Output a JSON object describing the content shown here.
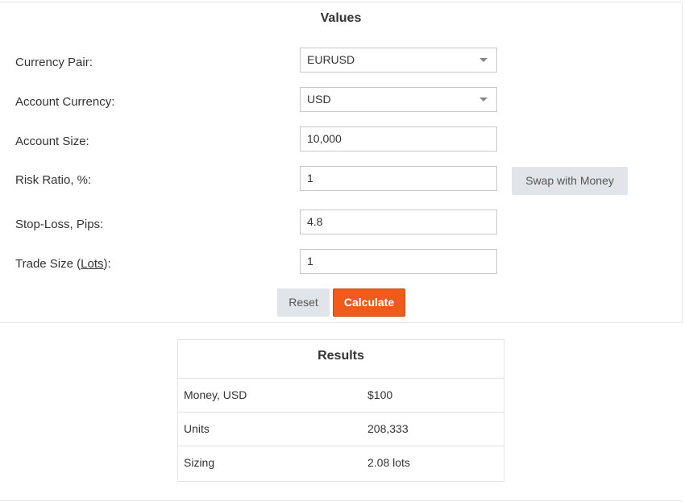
{
  "values": {
    "title": "Values",
    "currency_pair": {
      "label": "Currency Pair:",
      "value": "EURUSD"
    },
    "account_currency": {
      "label": "Account Currency:",
      "value": "USD"
    },
    "account_size": {
      "label": "Account Size:",
      "value": "10,000"
    },
    "risk_ratio": {
      "label": "Risk Ratio, %:",
      "value": "1"
    },
    "swap_button": "Swap with Money",
    "stop_loss": {
      "label": "Stop-Loss, Pips:",
      "value": "4.8"
    },
    "trade_size": {
      "label_prefix": "Trade Size (",
      "label_link": "Lots",
      "label_suffix": "):",
      "value": "1"
    },
    "reset_button": "Reset",
    "calculate_button": "Calculate"
  },
  "results": {
    "title": "Results",
    "rows": [
      {
        "key": "Money, USD",
        "value": "$100"
      },
      {
        "key": "Units",
        "value": "208,333"
      },
      {
        "key": "Sizing",
        "value": "2.08 lots"
      }
    ]
  },
  "colors": {
    "accent": "#f15a1a",
    "secondary_button": "#e1e4e8",
    "border": "#e4e4e4"
  },
  "icons": {
    "select_caret": "chevron-down-icon"
  }
}
